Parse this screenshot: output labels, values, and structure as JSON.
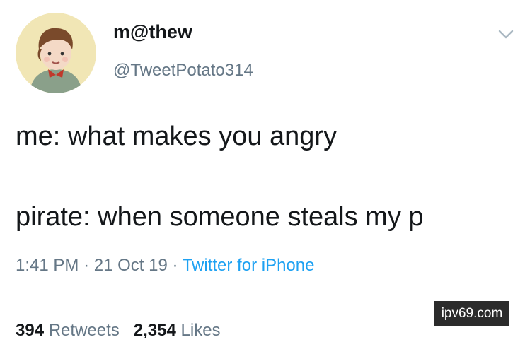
{
  "user": {
    "display_name": "m@thew",
    "handle": "@TweetPotato314",
    "avatar_icon": "cartoon-boy-avatar-icon"
  },
  "menu_icon": "chevron-down-icon",
  "tweet": {
    "lines": [
      "me: what makes you angry",
      "pirate: when someone steals my p"
    ]
  },
  "meta": {
    "time": "1:41 PM",
    "date": "21 Oct 19",
    "separator": "·",
    "source": "Twitter for iPhone"
  },
  "stats": {
    "retweets_count": "394",
    "retweets_label": "Retweets",
    "likes_count": "2,354",
    "likes_label": "Likes"
  },
  "watermark": "ipv69.com",
  "colors": {
    "text": "#14171a",
    "secondary": "#657786",
    "link": "#1da1f2"
  }
}
